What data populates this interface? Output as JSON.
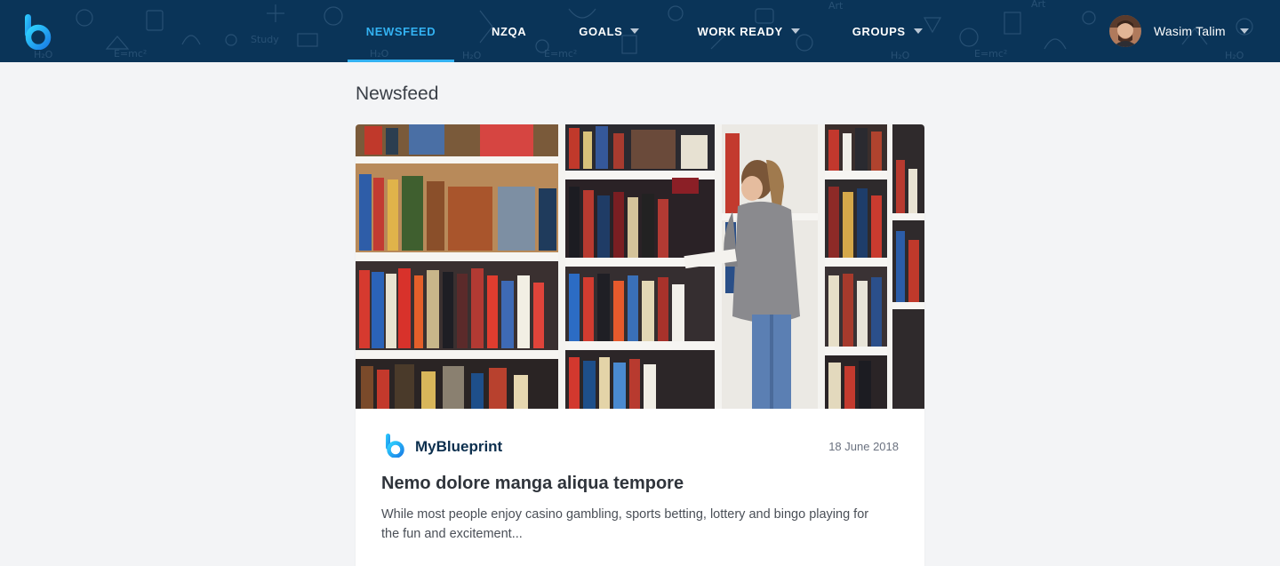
{
  "app": {
    "brand_color": "#33b2f2",
    "header_bg": "#0a3458"
  },
  "nav": {
    "items": [
      {
        "label": "NEWSFEED",
        "active": true,
        "dropdown": false
      },
      {
        "label": "NZQA",
        "active": false,
        "dropdown": false
      },
      {
        "label": "GOALS",
        "active": false,
        "dropdown": true
      },
      {
        "label": "WORK READY",
        "active": false,
        "dropdown": true
      },
      {
        "label": "GROUPS",
        "active": false,
        "dropdown": true
      }
    ]
  },
  "user": {
    "name": "Wasim Talim",
    "avatar_icon": "user-avatar"
  },
  "page": {
    "title": "Newsfeed"
  },
  "post": {
    "image_icon": "library-bookshelves-photo",
    "source_name": "MyBlueprint",
    "source_icon": "myblueprint-logo-icon",
    "date": "18 June 2018",
    "title": "Nemo dolore manga aliqua tempore",
    "excerpt": "While most people enjoy casino gambling, sports betting, lottery and bingo playing for the fun and excitement..."
  }
}
